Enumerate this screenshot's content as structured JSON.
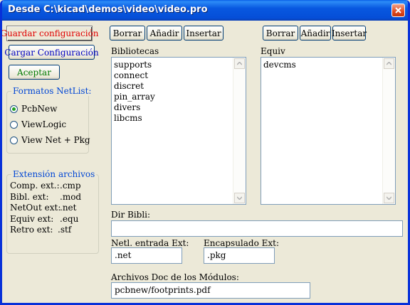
{
  "window": {
    "title": "Desde C:\\kicad\\demos\\video\\video.pro"
  },
  "left": {
    "save_config_label": "Guardar configuración",
    "load_config_label": "Cargar Configuración",
    "accept_label": "Aceptar",
    "colors": {
      "save": "#e00000",
      "load": "#0000c0",
      "accept": "#007800"
    }
  },
  "netlist": {
    "title": "Formatos NetList:",
    "options": [
      {
        "label": "PcbNew",
        "selected": true
      },
      {
        "label": "ViewLogic",
        "selected": false
      },
      {
        "label": "View Net + Pkg",
        "selected": false
      }
    ]
  },
  "extensions": {
    "title": "Extensión archivos",
    "rows": [
      {
        "label": "Comp. ext.:",
        "value": ".cmp"
      },
      {
        "label": "Bibl. ext:",
        "value": ".mod"
      },
      {
        "label": "NetOut ext:",
        "value": ".net"
      },
      {
        "label": "Equiv ext:",
        "value": ".equ"
      },
      {
        "label": "Retro ext:",
        "value": ".stf"
      }
    ]
  },
  "libraries": {
    "buttons": {
      "delete": "Borrar",
      "add": "Añadir",
      "insert": "Insertar"
    },
    "label": "Bibliotecas",
    "items": [
      "supports",
      "connect",
      "discret",
      "pin_array",
      "divers",
      "libcms"
    ]
  },
  "equiv": {
    "buttons": {
      "delete": "Borrar",
      "add": "Añadir",
      "insert": "Insertar"
    },
    "label": "Equiv",
    "items": [
      "devcms"
    ]
  },
  "dir_bibli": {
    "label": "Dir Bibli:",
    "value": ""
  },
  "netl_ext": {
    "label": "Netl. entrada Ext:",
    "value": ".net"
  },
  "pkg_ext": {
    "label": "Encapsulado Ext:",
    "value": ".pkg"
  },
  "doc_files": {
    "label": "Archivos Doc de los Módulos:",
    "value": "pcbnew/footprints.pdf"
  }
}
